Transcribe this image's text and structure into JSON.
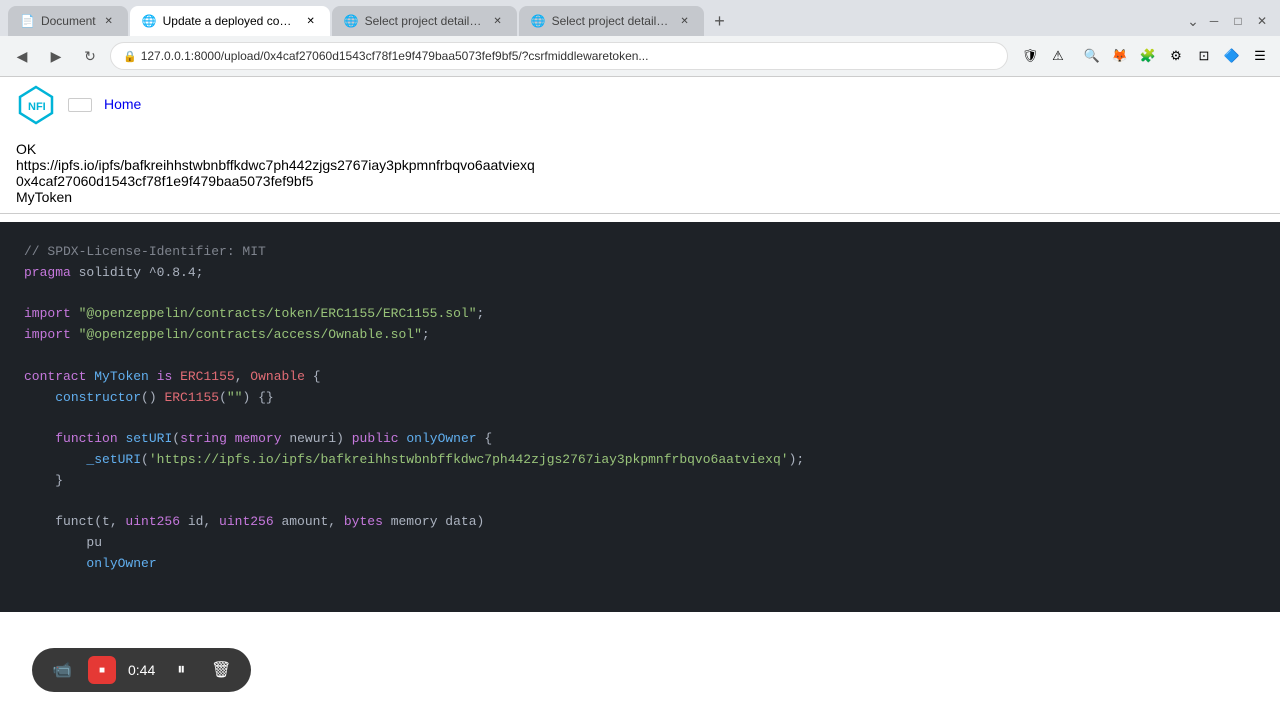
{
  "browser": {
    "tabs": [
      {
        "id": "tab-document",
        "label": "Document",
        "active": false,
        "favicon": "📄"
      },
      {
        "id": "tab-nftport",
        "label": "Update a deployed contract | NFTPort",
        "active": true,
        "favicon": "🌐"
      },
      {
        "id": "tab-django1",
        "label": "Select project details to change | Djan...",
        "active": false,
        "favicon": "🌐"
      },
      {
        "id": "tab-django2",
        "label": "Select project details to change | Djan...",
        "active": false,
        "favicon": "🌐"
      }
    ],
    "address": "127.0.0.1:8000/upload/0x4caf27060d1543cf78f1e9f479baa5073fef9bf5/?csrfmiddlewaretoken...",
    "nav_back": "◀",
    "nav_forward": "▶",
    "nav_refresh": "↻"
  },
  "navbar": {
    "home_link": "Home"
  },
  "result": {
    "status": "OK",
    "url": "https://ipfs.io/ipfs/bafkreihhstwbnbffkdwc7ph442zjgs2767iay3pkpmnfrbqvo6aatviexq",
    "address": "0x4caf27060d1543cf78f1e9f479baa5073fef9bf5",
    "name": "MyToken"
  },
  "code": {
    "lines": [
      "// SPDX-License-Identifier: MIT",
      "pragma solidity ^0.8.4;",
      "",
      "import \"@openzeppelin/contracts/token/ERC1155/ERC1155.sol\";",
      "import \"@openzeppelin/contracts/access/Ownable.sol\";",
      "",
      "contract MyToken is ERC1155, Ownable {",
      "    constructor() ERC1155(\"\") {}",
      "",
      "    function setURI(string memory newuri) public onlyOwner {",
      "        _setURI('https://ipfs.io/ipfs/bafkreihhstwbnbffkdwc7ph442zjgs2767iay3pkpmnfrbqvo6aatviexq');",
      "    }",
      "",
      "    funct(t, uint256 id, uint256 amount, bytes memory data)",
      "        pu",
      "        onlyOwner"
    ]
  },
  "recording": {
    "time": "0:44",
    "stop_label": "■",
    "pause_label": "⏸",
    "delete_label": "🗑"
  },
  "icons": {
    "camera": "📹",
    "stop": "■",
    "pause": "⏸",
    "delete": "🗑",
    "shield": "🛡",
    "warning": "⚠",
    "puzzle": "🧩",
    "extend": "⊕",
    "brave": "🦁",
    "metamask": "🦊",
    "other1": "⚙",
    "other2": "⊡",
    "menu": "☰"
  }
}
